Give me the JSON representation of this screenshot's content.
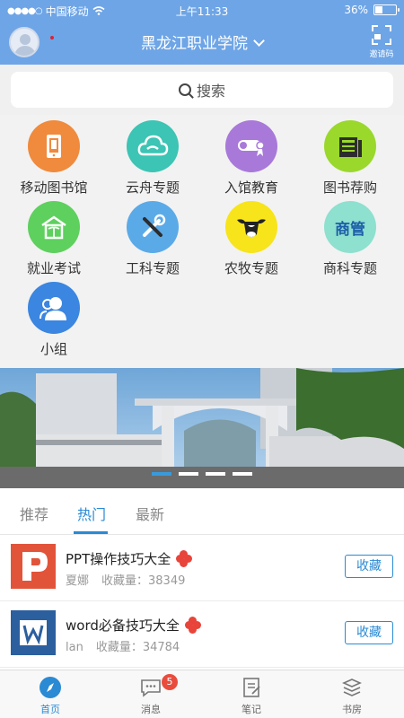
{
  "status_bar": {
    "carrier": "中国移动",
    "time": "上午11:33",
    "battery": "36%"
  },
  "header": {
    "title": "黑龙江职业学院",
    "invite_label": "邀请码"
  },
  "search": {
    "placeholder": "搜索"
  },
  "grid": [
    {
      "label": "移动图书馆",
      "icon": "mobile-library-icon",
      "color": "#f08a3c"
    },
    {
      "label": "云舟专题",
      "icon": "cloud-icon",
      "color": "#3cc4b4"
    },
    {
      "label": "入馆教育",
      "icon": "diploma-icon",
      "color": "#a879d9"
    },
    {
      "label": "图书荐购",
      "icon": "book-recommend-icon",
      "color": "#9ad82c"
    },
    {
      "label": "就业考试",
      "icon": "house-icon",
      "color": "#5ed05e"
    },
    {
      "label": "工科专题",
      "icon": "tools-icon",
      "color": "#5aaae8"
    },
    {
      "label": "农牧专题",
      "icon": "cow-icon",
      "color": "#f7e41a"
    },
    {
      "label": "商科专题",
      "icon": "shangguan-icon",
      "color": "#8ee0cf",
      "glyph": "商管"
    },
    {
      "label": "小组",
      "icon": "group-icon",
      "color": "#3b86e0"
    }
  ],
  "banner": {
    "pages": 4,
    "active_page": 1
  },
  "tabs": [
    "推荐",
    "热门",
    "最新"
  ],
  "active_tab": 1,
  "list": [
    {
      "title": "PPT操作技巧大全",
      "author": "夏娜",
      "favorites": "收藏量：38349",
      "button": "收藏",
      "thumb": "ppt-icon"
    },
    {
      "title": "word必备技巧大全",
      "author": "lan",
      "favorites": "收藏量：34784",
      "button": "收藏",
      "thumb": "word-icon"
    }
  ],
  "bottom_nav": [
    {
      "label": "首页",
      "icon": "compass-icon",
      "active": true
    },
    {
      "label": "消息",
      "icon": "message-icon",
      "badge": "5"
    },
    {
      "label": "笔记",
      "icon": "note-icon"
    },
    {
      "label": "书房",
      "icon": "bookshelf-icon"
    }
  ],
  "colors": {
    "header": "#6ea5e6",
    "accent": "#2a8ad4",
    "badge": "#e84c3d"
  }
}
